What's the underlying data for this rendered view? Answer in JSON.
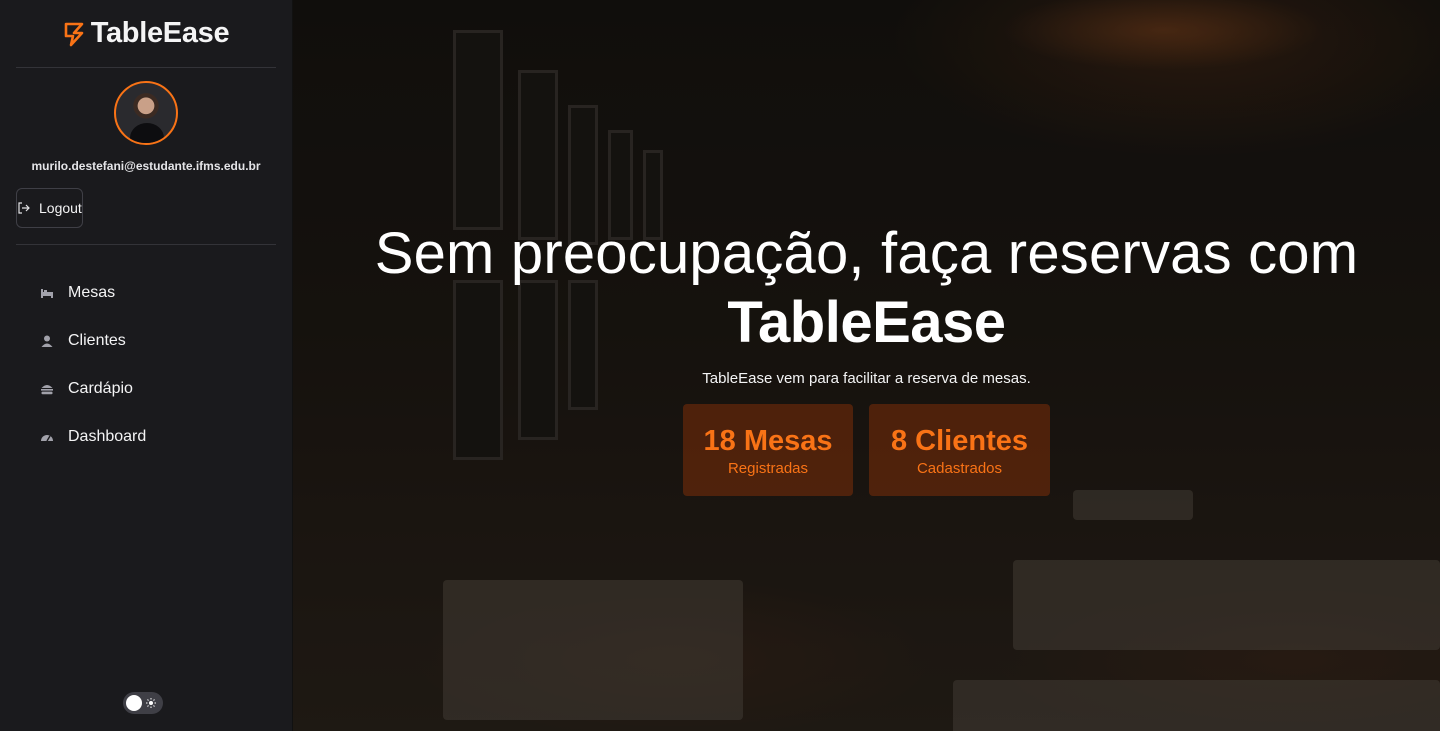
{
  "app": {
    "brand": "TableEase",
    "accent_color": "#f97316"
  },
  "sidebar": {
    "user": {
      "email": "murilo.destefani@estudante.ifms.edu.br"
    },
    "logout_label": "Logout",
    "nav": [
      {
        "label": "Mesas",
        "icon": "bed-icon"
      },
      {
        "label": "Clientes",
        "icon": "user-icon"
      },
      {
        "label": "Cardápio",
        "icon": "burger-icon"
      },
      {
        "label": "Dashboard",
        "icon": "gauge-icon"
      }
    ],
    "theme_toggle": {
      "icon": "sun-icon",
      "mode": "light"
    }
  },
  "hero": {
    "title": "Sem preocupação, faça reservas com",
    "brand": "TableEase",
    "subtitle": "TableEase vem para facilitar a reserva de mesas.",
    "stats": [
      {
        "value": "18 Mesas",
        "label": "Registradas"
      },
      {
        "value": "8 Clientes",
        "label": "Cadastrados"
      }
    ]
  }
}
